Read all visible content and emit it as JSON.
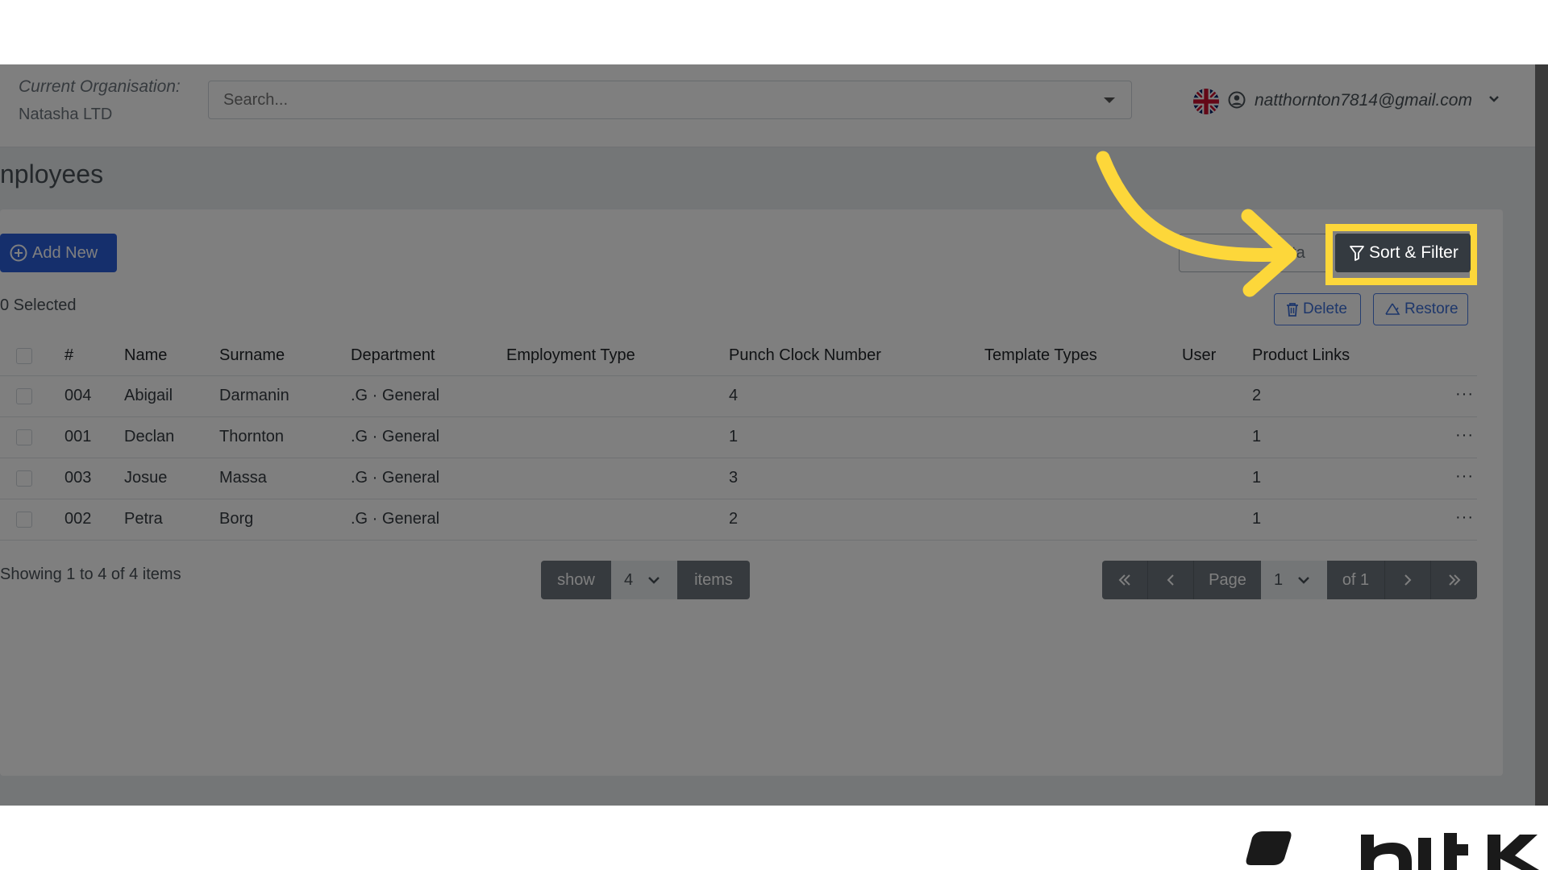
{
  "topbar": {
    "org_label": "Current Organisation:",
    "org_value": "Natasha LTD",
    "search_placeholder": "Search...",
    "user_email": "natthornton7814@gmail.com"
  },
  "page": {
    "title": "nployees"
  },
  "toolbar": {
    "add_new_label": "Add New",
    "export_label": "ata",
    "sort_filter_label": "Sort & Filter",
    "delete_label": "Delete",
    "restore_label": "Restore",
    "selected_text": "0 Selected"
  },
  "table": {
    "headers": [
      "#",
      "Name",
      "Surname",
      "Department",
      "Employment Type",
      "Punch Clock Number",
      "Template Types",
      "User",
      "Product Links"
    ],
    "rows": [
      {
        "id": "004",
        "name": "Abigail",
        "surname": "Darmanin",
        "department": ".G · General",
        "employment_type": "",
        "punch": "4",
        "template": "",
        "user": "",
        "links": "2",
        "more": "···"
      },
      {
        "id": "001",
        "name": "Declan",
        "surname": "Thornton",
        "department": ".G · General",
        "employment_type": "",
        "punch": "1",
        "template": "",
        "user": "",
        "links": "1",
        "more": "···"
      },
      {
        "id": "003",
        "name": "Josue",
        "surname": "Massa",
        "department": ".G · General",
        "employment_type": "",
        "punch": "3",
        "template": "",
        "user": "",
        "links": "1",
        "more": "···"
      },
      {
        "id": "002",
        "name": "Petra",
        "surname": "Borg",
        "department": ".G · General",
        "employment_type": "",
        "punch": "2",
        "template": "",
        "user": "",
        "links": "1",
        "more": "···"
      }
    ]
  },
  "footer": {
    "showing_text": "Showing 1 to 4 of 4 items",
    "show_label": "show",
    "page_size": "4",
    "items_label": "items",
    "page_label": "Page",
    "page_value": "1",
    "of_label": "of 1"
  },
  "colors": {
    "primary": "#2b5fd9",
    "dark_button": "#343a40",
    "highlight": "#fdd73a",
    "overlay": "rgba(0,0,0,0.5)"
  },
  "icons": [
    "plus-circle-icon",
    "filter-icon",
    "trash-icon",
    "recycle-icon",
    "user-circle-icon",
    "uk-flag-icon",
    "chevron-down-icon",
    "double-chevron-left-icon",
    "chevron-left-icon",
    "chevron-right-icon",
    "double-chevron-right-icon",
    "more-icon"
  ]
}
